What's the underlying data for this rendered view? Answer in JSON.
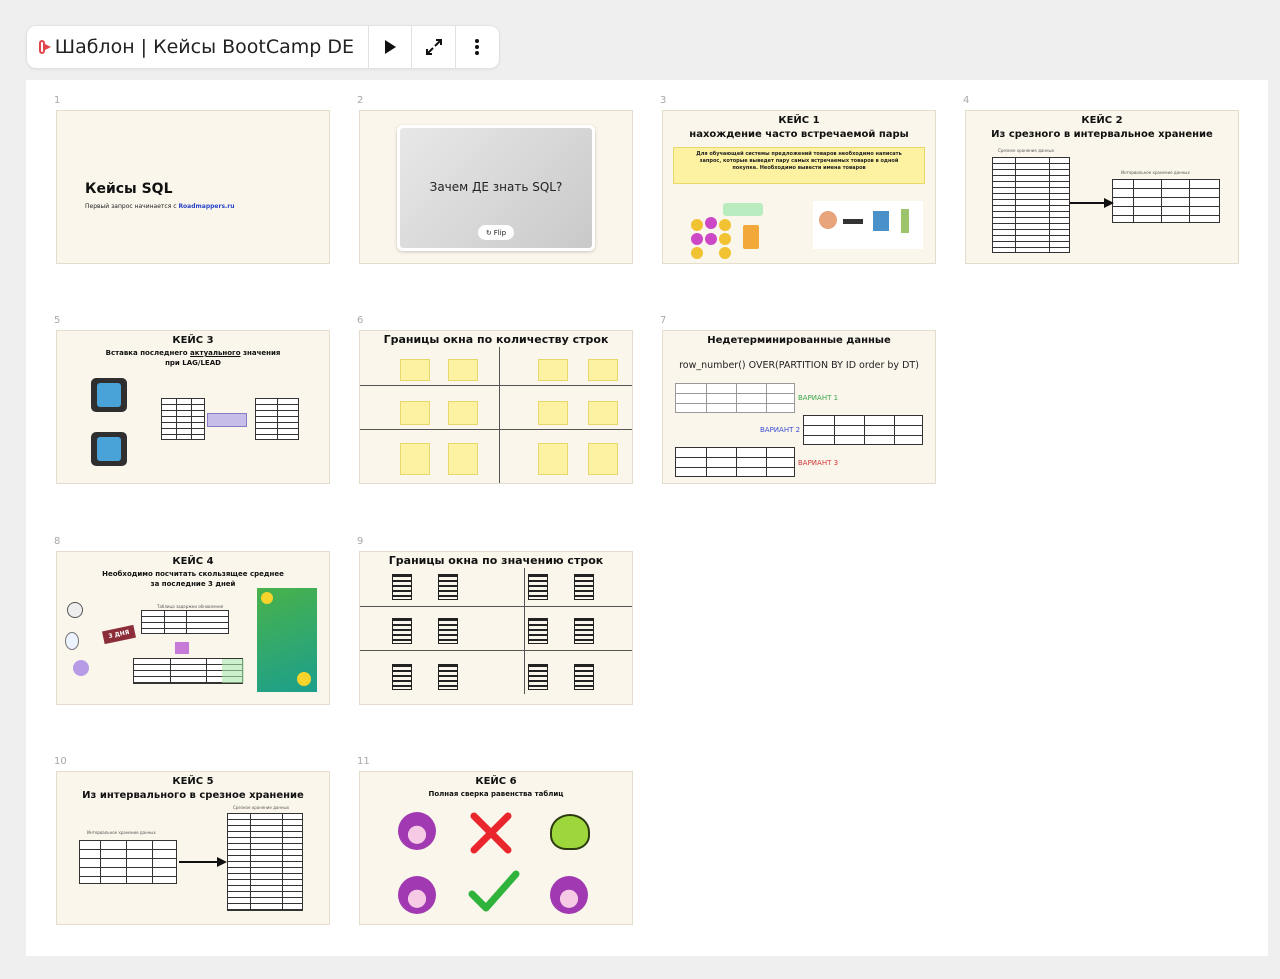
{
  "toolbar": {
    "title": "Шаблон | Кейсы BootCamp DE",
    "icons": [
      "slides-icon",
      "play-icon",
      "fullscreen-icon",
      "more-vertical-icon"
    ]
  },
  "slides": [
    {
      "num": "1",
      "title": "Кейсы SQL",
      "subtitle": "Первый запрос начинается с",
      "link": "Roadmappers.ru"
    },
    {
      "num": "2",
      "question": "Зачем ДЕ знать SQL?",
      "flip_label": "Flip"
    },
    {
      "num": "3",
      "title": "КЕЙС 1",
      "subtitle": "нахождение часто встречаемой пары",
      "task": "Для обучающей системы предложений товаров необходимо написать запрос, которые выведет пару самых встречаемых товаров в одной покупке. Необходимо вывести имена товаров"
    },
    {
      "num": "4",
      "title": "КЕЙС 2",
      "subtitle": "Из срезного в интервальное хранение",
      "left_caption": "Срезное хранение данных",
      "right_caption": "Интервальное хранение данных"
    },
    {
      "num": "5",
      "title": "КЕЙС 3",
      "subtitle_pre": "Вставка последнего ",
      "subtitle_u": "актуального",
      "subtitle_post": " значения",
      "subtitle2": "при LAG/LEAD"
    },
    {
      "num": "6",
      "title": "Границы окна по количеству строк"
    },
    {
      "num": "7",
      "title": "Недетерминированные данные",
      "query": "row_number() OVER(PARTITION BY ID order by DT)",
      "v1": "ВАРИАНТ 1",
      "v2": "ВАРИАНТ 2",
      "v3": "ВАРИАНТ 3"
    },
    {
      "num": "8",
      "title": "КЕЙС 4",
      "subtitle": "Необходимо посчитать скользящее среднее",
      "subtitle2": "за последние 3 дней",
      "table_caption": "Таблица задержки обновления",
      "arrow_label": "3 ДНЯ"
    },
    {
      "num": "9",
      "title": "Границы окна по значению строк"
    },
    {
      "num": "10",
      "title": "КЕЙС 5",
      "subtitle": "Из интервального в срезное хранение",
      "left_caption": "Интервальное хранение данных",
      "right_caption": "Срезное хранение данных"
    },
    {
      "num": "11",
      "title": "КЕЙС 6",
      "subtitle": "Полная сверка равенства таблиц"
    }
  ],
  "colors": {
    "slide_bg": "#faf6ec",
    "accent_red": "#e0474c",
    "highlight_yellow": "#fdf2a2",
    "check_green": "#2fb33a",
    "cross_red": "#e8262c"
  }
}
